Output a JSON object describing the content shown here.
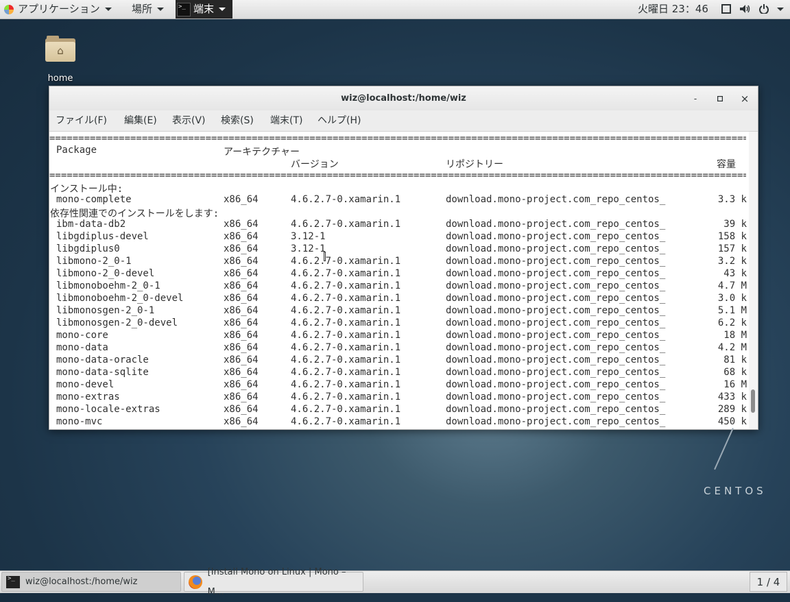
{
  "top_panel": {
    "applications": "アプリケーション",
    "places": "場所",
    "terminal": "端末",
    "clock": "火曜日 23：46"
  },
  "desktop": {
    "home_label": "home"
  },
  "window": {
    "title": "wiz@localhost:/home/wiz",
    "minimize": "-",
    "maximize": "▫",
    "close": "×",
    "menu": [
      "ファイル(F)",
      "編集(E)",
      "表示(V)",
      "検索(S)",
      "端末(T)",
      "ヘルプ(H)"
    ]
  },
  "terminal": {
    "separator": "====================================================================================================================================",
    "headers": {
      "package": "Package",
      "arch": "アーキテクチャー",
      "version": "バージョン",
      "repo": "リポジトリー",
      "size": "容量"
    },
    "section_installing": "インストール中:",
    "section_deps": "依存性関連でのインストールをします:",
    "main_package": {
      "name": "mono-complete",
      "arch": "x86_64",
      "version": "4.6.2.7-0.xamarin.1",
      "repo": "download.mono-project.com_repo_centos_",
      "size": "3.3 k"
    },
    "dependencies": [
      {
        "name": "ibm-data-db2",
        "arch": "x86_64",
        "version": "4.6.2.7-0.xamarin.1",
        "repo": "download.mono-project.com_repo_centos_",
        "size": "39 k"
      },
      {
        "name": "libgdiplus-devel",
        "arch": "x86_64",
        "version": "3.12-1",
        "repo": "download.mono-project.com_repo_centos_",
        "size": "158 k"
      },
      {
        "name": "libgdiplus0",
        "arch": "x86_64",
        "version": "3.12-1",
        "repo": "download.mono-project.com_repo_centos_",
        "size": "157 k"
      },
      {
        "name": "libmono-2_0-1",
        "arch": "x86_64",
        "version": "4.6.2.7-0.xamarin.1",
        "repo": "download.mono-project.com_repo_centos_",
        "size": "3.2 k"
      },
      {
        "name": "libmono-2_0-devel",
        "arch": "x86_64",
        "version": "4.6.2.7-0.xamarin.1",
        "repo": "download.mono-project.com_repo_centos_",
        "size": "43 k"
      },
      {
        "name": "libmonoboehm-2_0-1",
        "arch": "x86_64",
        "version": "4.6.2.7-0.xamarin.1",
        "repo": "download.mono-project.com_repo_centos_",
        "size": "4.7 M"
      },
      {
        "name": "libmonoboehm-2_0-devel",
        "arch": "x86_64",
        "version": "4.6.2.7-0.xamarin.1",
        "repo": "download.mono-project.com_repo_centos_",
        "size": "3.0 k"
      },
      {
        "name": "libmonosgen-2_0-1",
        "arch": "x86_64",
        "version": "4.6.2.7-0.xamarin.1",
        "repo": "download.mono-project.com_repo_centos_",
        "size": "5.1 M"
      },
      {
        "name": "libmonosgen-2_0-devel",
        "arch": "x86_64",
        "version": "4.6.2.7-0.xamarin.1",
        "repo": "download.mono-project.com_repo_centos_",
        "size": "6.2 k"
      },
      {
        "name": "mono-core",
        "arch": "x86_64",
        "version": "4.6.2.7-0.xamarin.1",
        "repo": "download.mono-project.com_repo_centos_",
        "size": "18 M"
      },
      {
        "name": "mono-data",
        "arch": "x86_64",
        "version": "4.6.2.7-0.xamarin.1",
        "repo": "download.mono-project.com_repo_centos_",
        "size": "4.2 M"
      },
      {
        "name": "mono-data-oracle",
        "arch": "x86_64",
        "version": "4.6.2.7-0.xamarin.1",
        "repo": "download.mono-project.com_repo_centos_",
        "size": "81 k"
      },
      {
        "name": "mono-data-sqlite",
        "arch": "x86_64",
        "version": "4.6.2.7-0.xamarin.1",
        "repo": "download.mono-project.com_repo_centos_",
        "size": "68 k"
      },
      {
        "name": "mono-devel",
        "arch": "x86_64",
        "version": "4.6.2.7-0.xamarin.1",
        "repo": "download.mono-project.com_repo_centos_",
        "size": "16 M"
      },
      {
        "name": "mono-extras",
        "arch": "x86_64",
        "version": "4.6.2.7-0.xamarin.1",
        "repo": "download.mono-project.com_repo_centos_",
        "size": "433 k"
      },
      {
        "name": "mono-locale-extras",
        "arch": "x86_64",
        "version": "4.6.2.7-0.xamarin.1",
        "repo": "download.mono-project.com_repo_centos_",
        "size": "289 k"
      },
      {
        "name": "mono-mvc",
        "arch": "x86_64",
        "version": "4.6.2.7-0.xamarin.1",
        "repo": "download.mono-project.com_repo_centos_",
        "size": "450 k"
      }
    ]
  },
  "branding": {
    "centos": "CENTOS"
  },
  "taskbar": {
    "tasks": [
      "wiz@localhost:/home/wiz",
      "[Install Mono on Linux | Mono – M…"
    ],
    "workspace": "1 / 4"
  }
}
